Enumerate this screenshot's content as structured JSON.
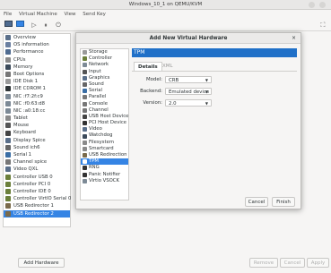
{
  "window": {
    "title": "Windows_10_1 on QEMU/KVM"
  },
  "menu": [
    "File",
    "Virtual Machine",
    "View",
    "Send Key"
  ],
  "sidebar": {
    "items": [
      {
        "label": "Overview",
        "icon": "monitor-icon",
        "color": "#5a6f8a"
      },
      {
        "label": "OS information",
        "icon": "info-icon",
        "color": "#6a7fa0"
      },
      {
        "label": "Performance",
        "icon": "performance-icon",
        "color": "#4f6b90"
      },
      {
        "label": "CPUs",
        "icon": "cpu-icon",
        "color": "#8a8a8a"
      },
      {
        "label": "Memory",
        "icon": "memory-icon",
        "color": "#3b4a5a"
      },
      {
        "label": "Boot Options",
        "icon": "gear-icon",
        "color": "#777777"
      },
      {
        "label": "IDE Disk 1",
        "icon": "disk-icon",
        "color": "#9a9a9a"
      },
      {
        "label": "IDE CDROM 1",
        "icon": "cdrom-icon",
        "color": "#2e3436"
      },
      {
        "label": "NIC :f7:2f:c9",
        "icon": "nic-icon",
        "color": "#7d8a96"
      },
      {
        "label": "NIC :f0:63:d8",
        "icon": "nic-icon",
        "color": "#7d8a96"
      },
      {
        "label": "NIC :a0:18:cc",
        "icon": "nic-icon",
        "color": "#7d8a96"
      },
      {
        "label": "Tablet",
        "icon": "tablet-icon",
        "color": "#8a8a8a"
      },
      {
        "label": "Mouse",
        "icon": "mouse-icon",
        "color": "#555555"
      },
      {
        "label": "Keyboard",
        "icon": "keyboard-icon",
        "color": "#444444"
      },
      {
        "label": "Display Spice",
        "icon": "display-icon",
        "color": "#5a6f8a"
      },
      {
        "label": "Sound ich6",
        "icon": "sound-icon",
        "color": "#666666"
      },
      {
        "label": "Serial 1",
        "icon": "serial-icon",
        "color": "#3a6ea5"
      },
      {
        "label": "Channel spice",
        "icon": "channel-icon",
        "color": "#777777"
      },
      {
        "label": "Video QXL",
        "icon": "video-icon",
        "color": "#5a6f8a"
      },
      {
        "label": "Controller USB 0",
        "icon": "controller-icon",
        "color": "#6b7f3a"
      },
      {
        "label": "Controller PCI 0",
        "icon": "controller-icon",
        "color": "#6b7f3a"
      },
      {
        "label": "Controller IDE 0",
        "icon": "controller-icon",
        "color": "#6b7f3a"
      },
      {
        "label": "Controller VirtIO Serial 0",
        "icon": "controller-icon",
        "color": "#6b7f3a"
      },
      {
        "label": "USB Redirector 1",
        "icon": "usb-icon",
        "color": "#7a6a4a"
      },
      {
        "label": "USB Redirector 2",
        "icon": "usb-icon",
        "color": "#7a6a4a",
        "selected": true
      }
    ]
  },
  "bottom": {
    "add_hardware": "Add Hardware",
    "remove": "Remove",
    "cancel": "Cancel",
    "apply": "Apply"
  },
  "dialog": {
    "title": "Add New Virtual Hardware",
    "close": "×",
    "device_types": [
      {
        "label": "Storage",
        "icon": "storage-icon",
        "color": "#9a9a9a"
      },
      {
        "label": "Controller",
        "icon": "controller-icon",
        "color": "#6b7f3a"
      },
      {
        "label": "Network",
        "icon": "network-icon",
        "color": "#7d8a96"
      },
      {
        "label": "Input",
        "icon": "input-icon",
        "color": "#555555"
      },
      {
        "label": "Graphics",
        "icon": "graphics-icon",
        "color": "#5a6f8a"
      },
      {
        "label": "Sound",
        "icon": "sound-icon",
        "color": "#666666"
      },
      {
        "label": "Serial",
        "icon": "serial-icon",
        "color": "#3a6ea5"
      },
      {
        "label": "Parallel",
        "icon": "parallel-icon",
        "color": "#777777"
      },
      {
        "label": "Console",
        "icon": "console-icon",
        "color": "#777777"
      },
      {
        "label": "Channel",
        "icon": "channel-icon",
        "color": "#777777"
      },
      {
        "label": "USB Host Device",
        "icon": "usb-icon",
        "color": "#444444"
      },
      {
        "label": "PCI Host Device",
        "icon": "pci-icon",
        "color": "#333333"
      },
      {
        "label": "Video",
        "icon": "video-icon",
        "color": "#5a6f8a"
      },
      {
        "label": "Watchdog",
        "icon": "watchdog-icon",
        "color": "#3b4a5a"
      },
      {
        "label": "Filesystem",
        "icon": "filesystem-icon",
        "color": "#8a8a8a"
      },
      {
        "label": "Smartcard",
        "icon": "smartcard-icon",
        "color": "#8a8a8a"
      },
      {
        "label": "USB Redirection",
        "icon": "usb-redirection-icon",
        "color": "#7a6a4a"
      },
      {
        "label": "TPM",
        "icon": "tpm-icon",
        "color": "#3584e4",
        "selected": true
      },
      {
        "label": "RNG",
        "icon": "rng-icon",
        "color": "#333333"
      },
      {
        "label": "Panic Notifier",
        "icon": "panic-icon",
        "color": "#333333"
      },
      {
        "label": "Virtio VSOCK",
        "icon": "vsock-icon",
        "color": "#7d8a96"
      }
    ],
    "header": "TPM",
    "tabs": {
      "details": "Details",
      "xml": "XML"
    },
    "fields": {
      "model_label": "Model:",
      "model_value": "CRB",
      "backend_label": "Backend:",
      "backend_value": "Emulated device",
      "version_label": "Version:",
      "version_value": "2.0"
    },
    "buttons": {
      "cancel": "Cancel",
      "finish": "Finish"
    }
  }
}
